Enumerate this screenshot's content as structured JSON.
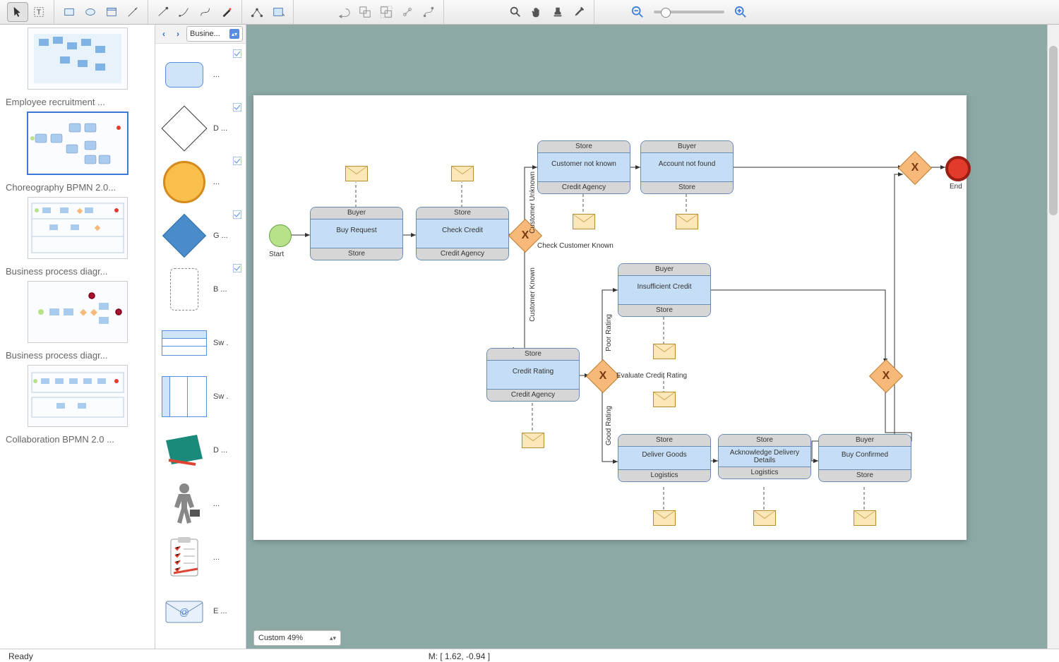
{
  "toolbar": {
    "zoom": "slider"
  },
  "nav": {
    "back": "‹",
    "forward": "›",
    "category": "Busine..."
  },
  "shapes": [
    {
      "name": "..."
    },
    {
      "name": "D ..."
    },
    {
      "name": "..."
    },
    {
      "name": "G ..."
    },
    {
      "name": "B ..."
    },
    {
      "name": "Sw ."
    },
    {
      "name": "Sw ."
    },
    {
      "name": "D ..."
    },
    {
      "name": "..."
    },
    {
      "name": "..."
    },
    {
      "name": "E ..."
    }
  ],
  "thumbs": [
    {
      "label": "Employee recruitment ..."
    },
    {
      "label": "Choreography BPMN 2.0..."
    },
    {
      "label": "Business process diagr..."
    },
    {
      "label": "Business process diagr..."
    },
    {
      "label": "Collaboration BPMN 2.0 ..."
    }
  ],
  "zoom_display": "Custom 49%",
  "status": {
    "ready": "Ready",
    "mouse": "M: [ 1.62, -0.94 ]"
  },
  "diagram": {
    "start": "Start",
    "end": "End",
    "tasks": {
      "buy": {
        "top": "Buyer",
        "body": "Buy Request",
        "bot": "Store"
      },
      "check": {
        "top": "Store",
        "body": "Check Credit",
        "bot": "Credit Agency"
      },
      "cnk": {
        "top": "Store",
        "body": "Customer not known",
        "bot": "Credit Agency"
      },
      "anf": {
        "top": "Buyer",
        "body": "Account not found",
        "bot": "Store"
      },
      "rating": {
        "top": "Store",
        "body": "Credit Rating",
        "bot": "Credit Agency"
      },
      "insuf": {
        "top": "Buyer",
        "body": "Insufficient Credit",
        "bot": "Store"
      },
      "deliver": {
        "top": "Store",
        "body": "Deliver Goods",
        "bot": "Logistics"
      },
      "ack": {
        "top": "Store",
        "body": "Acknowledge Delivery Details",
        "bot": "Logistics"
      },
      "confirm": {
        "top": "Buyer",
        "body": "Buy Confirmed",
        "bot": "Store"
      }
    },
    "gateways": {
      "g1": "X",
      "g2": "X",
      "g3": "X",
      "g4": "X"
    },
    "labels": {
      "g1": "Check Customer Known",
      "g2": "Evaluate Credit Rating",
      "unk": "Customer Unknown",
      "known": "Customer Known",
      "poor": "Poor Rating",
      "good": "Good Rating"
    }
  }
}
